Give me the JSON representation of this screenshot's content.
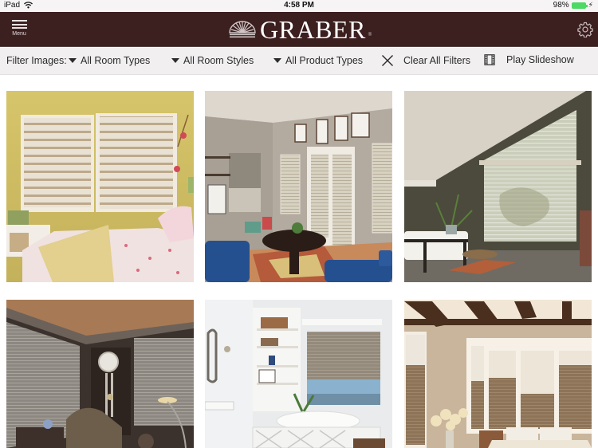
{
  "status_bar": {
    "device": "iPad",
    "wifi_icon": "wifi-icon",
    "time": "4:58 PM",
    "battery_percent": "98%",
    "battery_level": 0.98,
    "battery_icon": "battery-icon",
    "charging_icon": "charging-bolt-icon"
  },
  "header": {
    "menu_label": "Menu",
    "menu_icon": "hamburger-icon",
    "logo_text": "GRABER",
    "logo_reg": "®",
    "logo_icon": "graber-sunburst-logo-icon",
    "settings_icon": "gear-icon",
    "background": "#3c1f1f"
  },
  "filter_bar": {
    "label": "Filter Images:",
    "filters": [
      {
        "label": "All Room Types",
        "icon": "caret-down-icon"
      },
      {
        "label": "All Room Styles",
        "icon": "caret-down-icon"
      },
      {
        "label": "All Product Types",
        "icon": "caret-down-icon"
      }
    ],
    "clear_label": "Clear All Filters",
    "clear_icon": "close-icon",
    "slideshow_label": "Play Slideshow",
    "slideshow_icon": "film-icon"
  },
  "gallery": {
    "images": [
      {
        "alt": "Yellow bedroom with sheer banded shades and pink quilted bed"
      },
      {
        "alt": "Family room with mini blinds on French doors, blue sofas and round table"
      },
      {
        "alt": "Bathroom with angled window and sheer shades over freestanding tub"
      },
      {
        "alt": "Dark den with horizontal blinds, wall clock and armchair"
      },
      {
        "alt": "White bathroom with cellular shades over soaking tub and shelving"
      },
      {
        "alt": "Bedroom with wood beams and top-down cellular shades on bay window"
      }
    ]
  }
}
